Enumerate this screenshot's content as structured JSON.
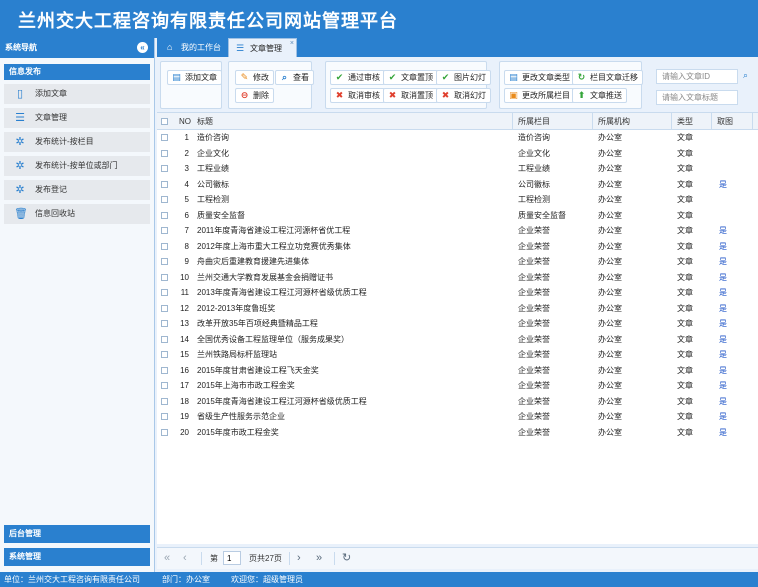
{
  "header": {
    "title": "兰州交大工程咨询有限责任公司网站管理平台"
  },
  "sidebar": {
    "title": "系统导航",
    "group": "信息发布",
    "items": [
      {
        "label": "添加文章",
        "icon": "document-icon"
      },
      {
        "label": "文章管理",
        "icon": "list-icon"
      },
      {
        "label": "发布统计-按栏目",
        "icon": "gear-icon"
      },
      {
        "label": "发布统计-按单位或部门",
        "icon": "gear-icon"
      },
      {
        "label": "发布登记",
        "icon": "gear-icon"
      },
      {
        "label": "信息回收站",
        "icon": "trash-icon"
      }
    ],
    "bottom": [
      "后台管理",
      "系统管理"
    ]
  },
  "tabs": [
    {
      "label": "我的工作台",
      "icon": "home-icon"
    },
    {
      "label": "文章管理",
      "icon": "list-icon",
      "close": "×"
    }
  ],
  "toolbar": {
    "add": "添加文章",
    "edit": "修改",
    "view": "查看",
    "delete": "删除",
    "approve": "通过审核",
    "cancel_approve": "取消审核",
    "top": "文章置顶",
    "cancel_top": "取消置顶",
    "slide": "图片幻灯",
    "cancel_slide": "取消幻灯",
    "change_type": "更改文章类型",
    "change_column": "更改所属栏目",
    "migrate": "栏目文章迁移",
    "push": "文章推送",
    "search_id_placeholder": "请输入文章ID",
    "search_title_placeholder": "请输入文章标题"
  },
  "grid": {
    "headers": {
      "no": "NO",
      "title": "标题",
      "column": "所属栏目",
      "org": "所属机构",
      "type": "类型",
      "image": "取图"
    },
    "rows": [
      {
        "no": "1",
        "title": "造价咨询",
        "column": "造价咨询",
        "org": "办公室",
        "type": "文章",
        "image": ""
      },
      {
        "no": "2",
        "title": "企业文化",
        "column": "企业文化",
        "org": "办公室",
        "type": "文章",
        "image": ""
      },
      {
        "no": "3",
        "title": "工程业绩",
        "column": "工程业绩",
        "org": "办公室",
        "type": "文章",
        "image": ""
      },
      {
        "no": "4",
        "title": "公司徽标",
        "column": "公司徽标",
        "org": "办公室",
        "type": "文章",
        "image": "是"
      },
      {
        "no": "5",
        "title": "工程检测",
        "column": "工程检测",
        "org": "办公室",
        "type": "文章",
        "image": ""
      },
      {
        "no": "6",
        "title": "质量安全监督",
        "column": "质量安全监督",
        "org": "办公室",
        "type": "文章",
        "image": ""
      },
      {
        "no": "7",
        "title": "2011年度青海省建设工程江河源杯省优工程",
        "column": "企业荣誉",
        "org": "办公室",
        "type": "文章",
        "image": "是"
      },
      {
        "no": "8",
        "title": "2012年度上海市重大工程立功竞赛优秀集体",
        "column": "企业荣誉",
        "org": "办公室",
        "type": "文章",
        "image": "是"
      },
      {
        "no": "9",
        "title": "舟曲灾后重建教育援建先进集体",
        "column": "企业荣誉",
        "org": "办公室",
        "type": "文章",
        "image": "是"
      },
      {
        "no": "10",
        "title": "兰州交通大学教育发展基金会捐赠证书",
        "column": "企业荣誉",
        "org": "办公室",
        "type": "文章",
        "image": "是"
      },
      {
        "no": "11",
        "title": "2013年度青海省建设工程江河源杯省级优质工程",
        "column": "企业荣誉",
        "org": "办公室",
        "type": "文章",
        "image": "是"
      },
      {
        "no": "12",
        "title": "2012-2013年度鲁班奖",
        "column": "企业荣誉",
        "org": "办公室",
        "type": "文章",
        "image": "是"
      },
      {
        "no": "13",
        "title": "改革开放35年百项经典暨精品工程",
        "column": "企业荣誉",
        "org": "办公室",
        "type": "文章",
        "image": "是"
      },
      {
        "no": "14",
        "title": "全国优秀设备工程监理单位（服务成果奖）",
        "column": "企业荣誉",
        "org": "办公室",
        "type": "文章",
        "image": "是"
      },
      {
        "no": "15",
        "title": "兰州铁路局标杆监理站",
        "column": "企业荣誉",
        "org": "办公室",
        "type": "文章",
        "image": "是"
      },
      {
        "no": "16",
        "title": "2015年度甘肃省建设工程飞天金奖",
        "column": "企业荣誉",
        "org": "办公室",
        "type": "文章",
        "image": "是"
      },
      {
        "no": "17",
        "title": "2015年上海市市政工程金奖",
        "column": "企业荣誉",
        "org": "办公室",
        "type": "文章",
        "image": "是"
      },
      {
        "no": "18",
        "title": "2015年度青海省建设工程江河源杯省级优质工程",
        "column": "企业荣誉",
        "org": "办公室",
        "type": "文章",
        "image": "是"
      },
      {
        "no": "19",
        "title": "省级生产性服务示范企业",
        "column": "企业荣誉",
        "org": "办公室",
        "type": "文章",
        "image": "是"
      },
      {
        "no": "20",
        "title": "2015年度市政工程金奖",
        "column": "企业荣誉",
        "org": "办公室",
        "type": "文章",
        "image": "是"
      }
    ]
  },
  "pager": {
    "page_prefix": "第",
    "page_value": "1",
    "page_suffix": "页共27页"
  },
  "status": {
    "unit": "单位：兰州交大工程咨询有限责任公司",
    "dept": "部门：办公室",
    "welcome": "欢迎您：超级管理员"
  }
}
